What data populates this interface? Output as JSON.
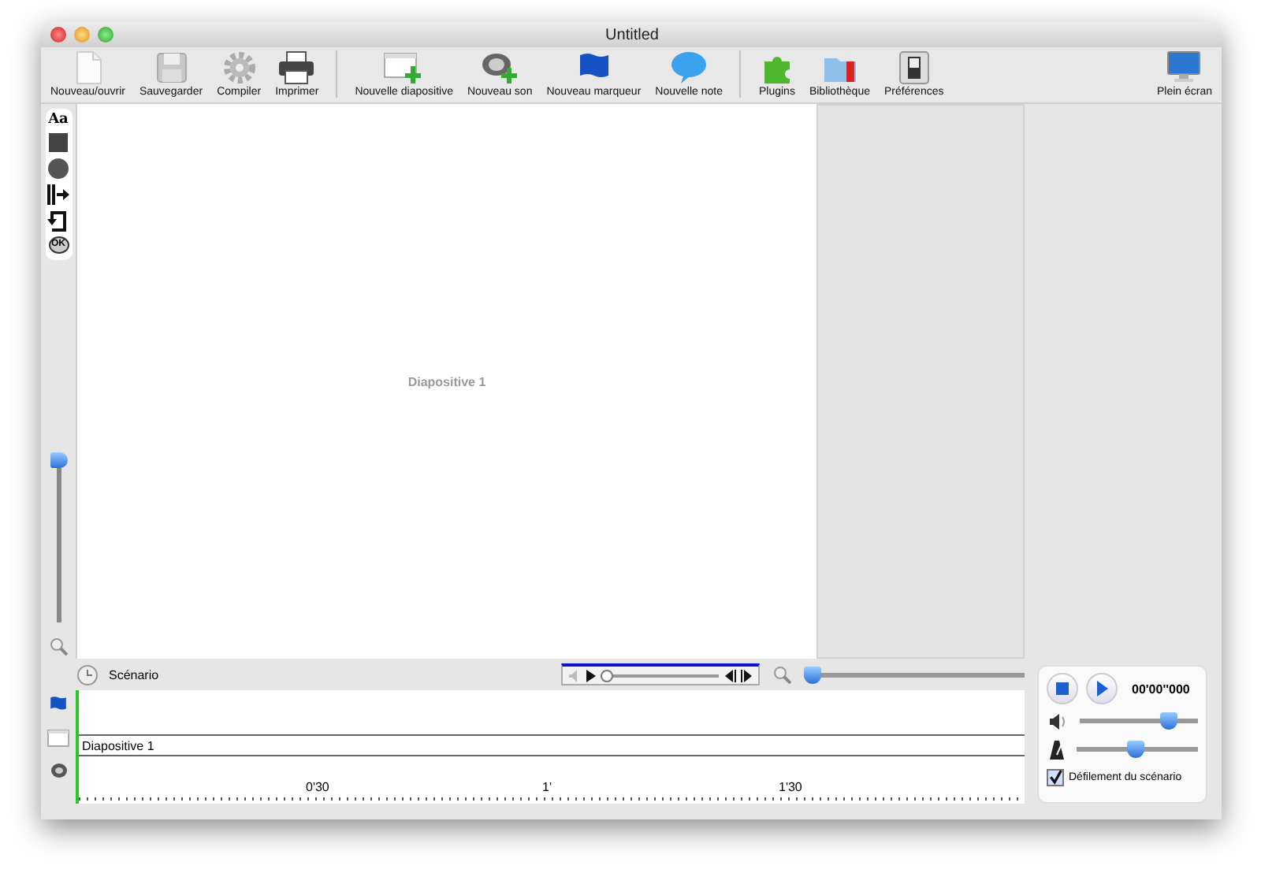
{
  "window": {
    "title": "Untitled"
  },
  "toolbar": {
    "groups": [
      [
        "Nouveau/ouvrir",
        "Sauvegarder",
        "Compiler",
        "Imprimer"
      ],
      [
        "Nouvelle diapositive",
        "Nouveau son",
        "Nouveau marqueur",
        "Nouvelle note"
      ],
      [
        "Plugins",
        "Bibliothèque",
        "Préférences"
      ]
    ],
    "right_items": [
      "Plein écran"
    ]
  },
  "tools": [
    {
      "kind": "text",
      "label": "Aa"
    },
    {
      "kind": "rectangle"
    },
    {
      "kind": "circle"
    },
    {
      "kind": "arrows"
    },
    {
      "kind": "loop"
    },
    {
      "kind": "badge",
      "label": "OK"
    }
  ],
  "slide_zoom": {
    "level": 1
  },
  "slide": {
    "title": "Diapositive 1"
  },
  "scenario": {
    "label": "Scénario",
    "player": {
      "level": 0
    },
    "zoom": {
      "level": 0
    }
  },
  "timeline": {
    "slide_row": "Diapositive 1",
    "ruler": [
      "0'30",
      "1'",
      "1'30"
    ]
  },
  "playback": {
    "time": "00'00''000",
    "volume": {
      "level": 0.75
    },
    "tempo": {
      "level": 0.48
    },
    "scroll": {
      "label": "Défilement du scénario",
      "checked": true
    }
  }
}
